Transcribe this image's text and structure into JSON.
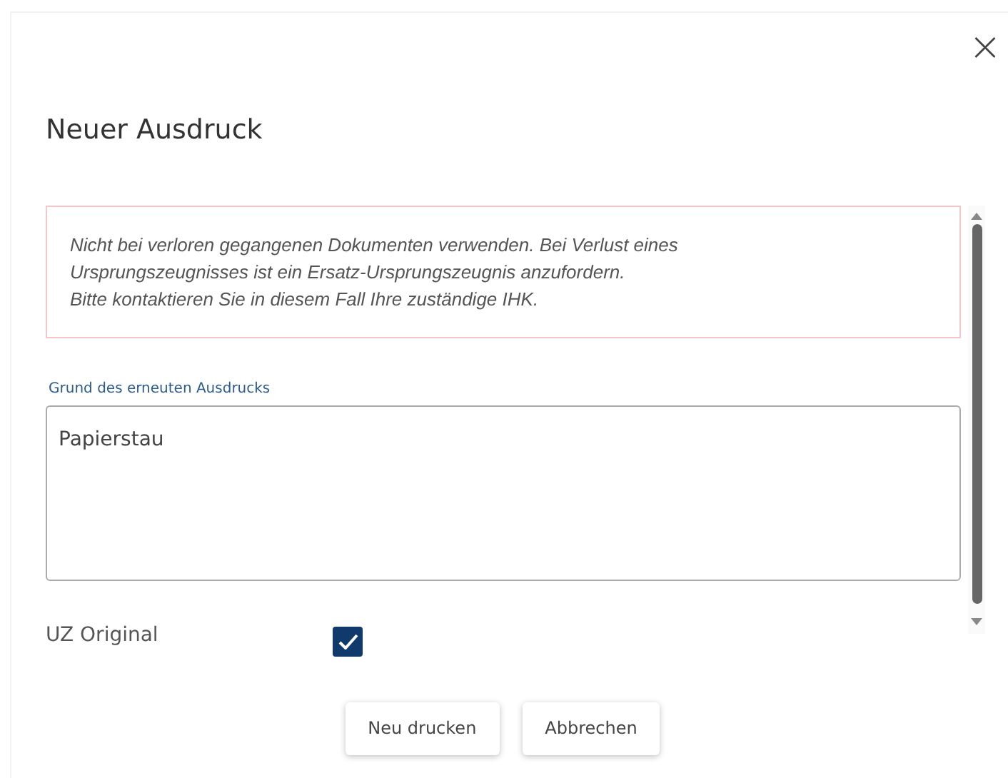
{
  "dialog": {
    "title": "Neuer Ausdruck",
    "close": "×"
  },
  "notice": {
    "lines": [
      "Nicht bei verloren gegangenen Dokumenten verwenden. Bei Verlust eines",
      "Ursprungszeugnisses ist ein Ersatz-Ursprungszeugnis anzufordern.",
      "Bitte kontaktieren Sie in diesem Fall Ihre zuständige IHK."
    ]
  },
  "reason_field": {
    "label": "Grund des erneuten Ausdrucks",
    "value": "Papierstau"
  },
  "uz_original": {
    "label": "UZ Original",
    "checked": true
  },
  "buttons": [
    "Neu drucken",
    "Abbrechen"
  ]
}
